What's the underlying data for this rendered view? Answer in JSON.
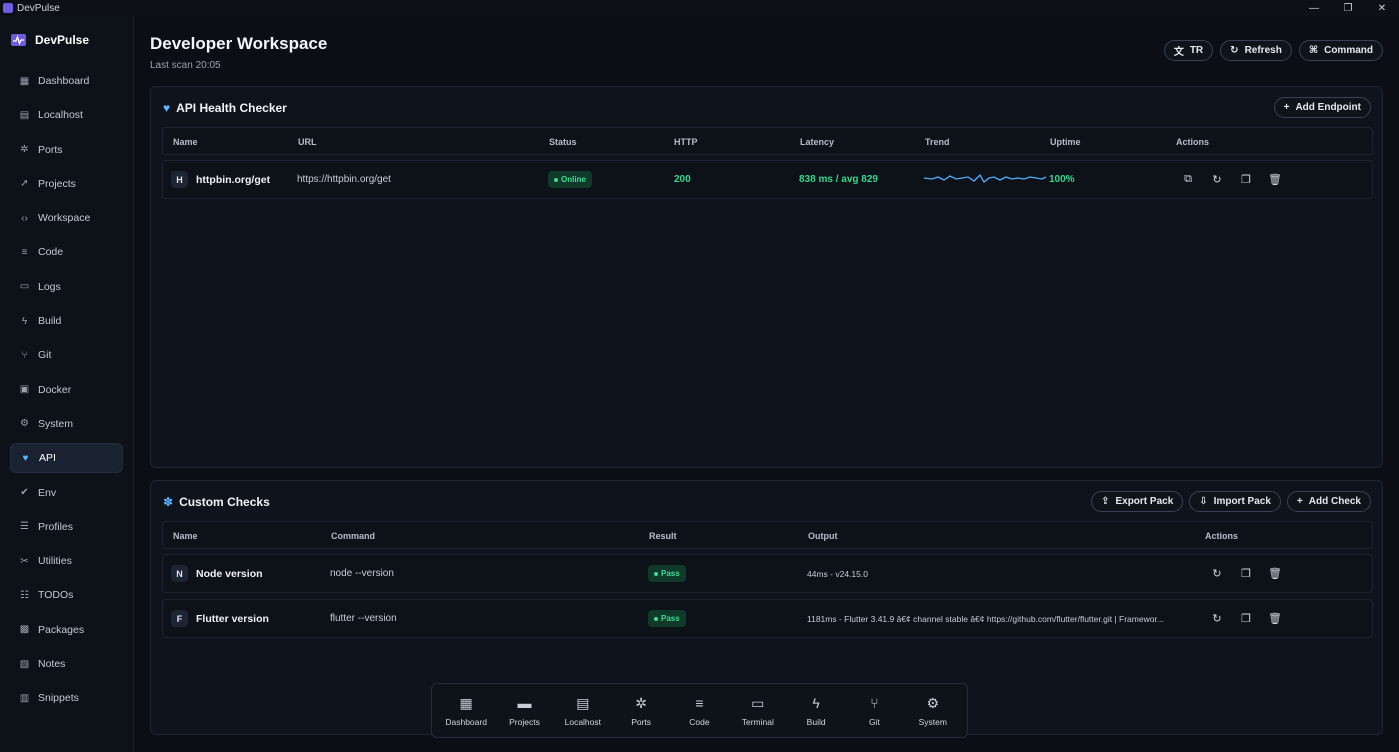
{
  "window": {
    "title": "DevPulse",
    "minimize": "—",
    "maximize": "❐",
    "close": "✕"
  },
  "sidebar": {
    "brand": "DevPulse",
    "items": [
      {
        "label": "Dashboard",
        "icon": "dashboard-icon"
      },
      {
        "label": "Localhost",
        "icon": "server-icon"
      },
      {
        "label": "Ports",
        "icon": "ports-icon"
      },
      {
        "label": "Projects",
        "icon": "rocket-icon"
      },
      {
        "label": "Workspace",
        "icon": "code-brackets-icon"
      },
      {
        "label": "Code",
        "icon": "code-icon"
      },
      {
        "label": "Logs",
        "icon": "logs-icon"
      },
      {
        "label": "Build",
        "icon": "bolt-icon"
      },
      {
        "label": "Git",
        "icon": "git-icon"
      },
      {
        "label": "Docker",
        "icon": "docker-icon"
      },
      {
        "label": "System",
        "icon": "gear-icon"
      },
      {
        "label": "API",
        "icon": "heart-icon"
      },
      {
        "label": "Env",
        "icon": "check-icon"
      },
      {
        "label": "Profiles",
        "icon": "sliders-icon"
      },
      {
        "label": "Utilities",
        "icon": "tools-icon"
      },
      {
        "label": "TODOs",
        "icon": "todo-icon"
      },
      {
        "label": "Packages",
        "icon": "package-icon"
      },
      {
        "label": "Notes",
        "icon": "notes-icon"
      },
      {
        "label": "Snippets",
        "icon": "snippets-icon"
      }
    ],
    "active_item": "API"
  },
  "header": {
    "title": "Developer Workspace",
    "subtitle": "Last scan 20:05",
    "lang_label": "TR",
    "refresh_label": "Refresh",
    "command_label": "Command"
  },
  "api_health": {
    "title": "API Health Checker",
    "add_label": "Add Endpoint",
    "columns": [
      "Name",
      "URL",
      "Status",
      "HTTP",
      "Latency",
      "Trend",
      "Uptime",
      "Actions"
    ],
    "rows": [
      {
        "initial": "H",
        "name": "httpbin.org/get",
        "url": "https://httpbin.org/get",
        "status": "Online",
        "http": "200",
        "latency": "838 ms / avg 829",
        "uptime": "100%"
      }
    ]
  },
  "custom_checks": {
    "title": "Custom Checks",
    "export_label": "Export Pack",
    "import_label": "Import Pack",
    "add_label": "Add Check",
    "columns": [
      "Name",
      "Command",
      "Result",
      "Output",
      "Actions"
    ],
    "rows": [
      {
        "initial": "N",
        "name": "Node version",
        "command": "node --version",
        "result": "Pass",
        "output": "44ms - v24.15.0"
      },
      {
        "initial": "F",
        "name": "Flutter version",
        "command": "flutter --version",
        "result": "Pass",
        "output": "1181ms - Flutter 3.41.9 â€¢ channel stable â€¢ https://github.com/flutter/flutter.git | Framewor..."
      }
    ]
  },
  "dock": {
    "items": [
      "Dashboard",
      "Projects",
      "Localhost",
      "Ports",
      "Code",
      "Terminal",
      "Build",
      "Git",
      "System"
    ]
  },
  "colors": {
    "accent": "#5ab4ff",
    "success": "#34d58e",
    "background": "#0b0e14"
  }
}
